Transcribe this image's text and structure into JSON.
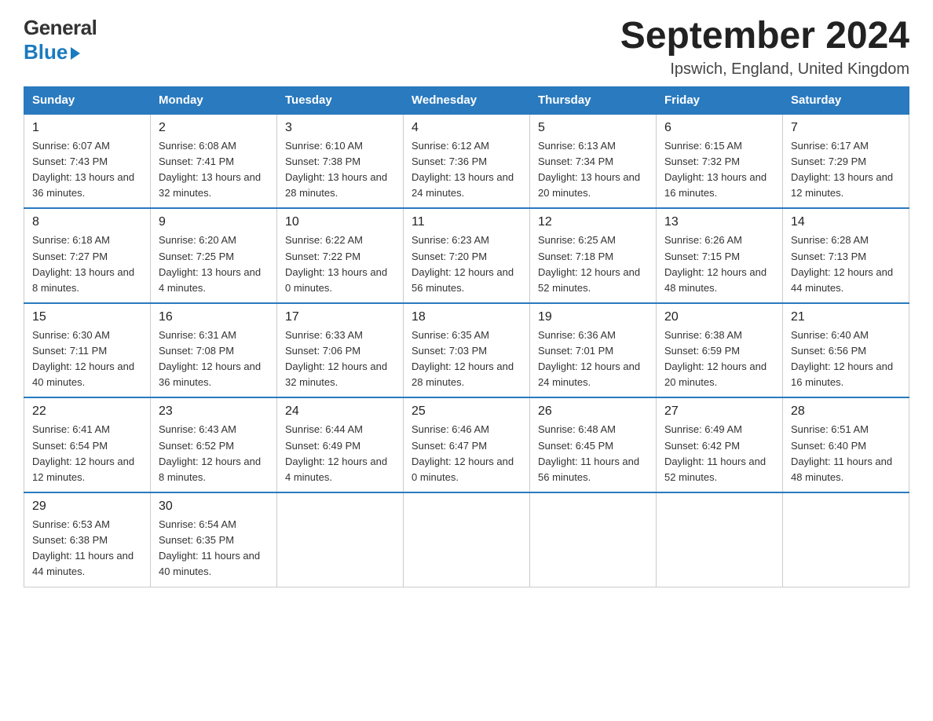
{
  "logo": {
    "general": "General",
    "blue": "Blue"
  },
  "title": "September 2024",
  "location": "Ipswich, England, United Kingdom",
  "days_of_week": [
    "Sunday",
    "Monday",
    "Tuesday",
    "Wednesday",
    "Thursday",
    "Friday",
    "Saturday"
  ],
  "weeks": [
    [
      {
        "num": "1",
        "sunrise": "6:07 AM",
        "sunset": "7:43 PM",
        "daylight": "13 hours and 36 minutes."
      },
      {
        "num": "2",
        "sunrise": "6:08 AM",
        "sunset": "7:41 PM",
        "daylight": "13 hours and 32 minutes."
      },
      {
        "num": "3",
        "sunrise": "6:10 AM",
        "sunset": "7:38 PM",
        "daylight": "13 hours and 28 minutes."
      },
      {
        "num": "4",
        "sunrise": "6:12 AM",
        "sunset": "7:36 PM",
        "daylight": "13 hours and 24 minutes."
      },
      {
        "num": "5",
        "sunrise": "6:13 AM",
        "sunset": "7:34 PM",
        "daylight": "13 hours and 20 minutes."
      },
      {
        "num": "6",
        "sunrise": "6:15 AM",
        "sunset": "7:32 PM",
        "daylight": "13 hours and 16 minutes."
      },
      {
        "num": "7",
        "sunrise": "6:17 AM",
        "sunset": "7:29 PM",
        "daylight": "13 hours and 12 minutes."
      }
    ],
    [
      {
        "num": "8",
        "sunrise": "6:18 AM",
        "sunset": "7:27 PM",
        "daylight": "13 hours and 8 minutes."
      },
      {
        "num": "9",
        "sunrise": "6:20 AM",
        "sunset": "7:25 PM",
        "daylight": "13 hours and 4 minutes."
      },
      {
        "num": "10",
        "sunrise": "6:22 AM",
        "sunset": "7:22 PM",
        "daylight": "13 hours and 0 minutes."
      },
      {
        "num": "11",
        "sunrise": "6:23 AM",
        "sunset": "7:20 PM",
        "daylight": "12 hours and 56 minutes."
      },
      {
        "num": "12",
        "sunrise": "6:25 AM",
        "sunset": "7:18 PM",
        "daylight": "12 hours and 52 minutes."
      },
      {
        "num": "13",
        "sunrise": "6:26 AM",
        "sunset": "7:15 PM",
        "daylight": "12 hours and 48 minutes."
      },
      {
        "num": "14",
        "sunrise": "6:28 AM",
        "sunset": "7:13 PM",
        "daylight": "12 hours and 44 minutes."
      }
    ],
    [
      {
        "num": "15",
        "sunrise": "6:30 AM",
        "sunset": "7:11 PM",
        "daylight": "12 hours and 40 minutes."
      },
      {
        "num": "16",
        "sunrise": "6:31 AM",
        "sunset": "7:08 PM",
        "daylight": "12 hours and 36 minutes."
      },
      {
        "num": "17",
        "sunrise": "6:33 AM",
        "sunset": "7:06 PM",
        "daylight": "12 hours and 32 minutes."
      },
      {
        "num": "18",
        "sunrise": "6:35 AM",
        "sunset": "7:03 PM",
        "daylight": "12 hours and 28 minutes."
      },
      {
        "num": "19",
        "sunrise": "6:36 AM",
        "sunset": "7:01 PM",
        "daylight": "12 hours and 24 minutes."
      },
      {
        "num": "20",
        "sunrise": "6:38 AM",
        "sunset": "6:59 PM",
        "daylight": "12 hours and 20 minutes."
      },
      {
        "num": "21",
        "sunrise": "6:40 AM",
        "sunset": "6:56 PM",
        "daylight": "12 hours and 16 minutes."
      }
    ],
    [
      {
        "num": "22",
        "sunrise": "6:41 AM",
        "sunset": "6:54 PM",
        "daylight": "12 hours and 12 minutes."
      },
      {
        "num": "23",
        "sunrise": "6:43 AM",
        "sunset": "6:52 PM",
        "daylight": "12 hours and 8 minutes."
      },
      {
        "num": "24",
        "sunrise": "6:44 AM",
        "sunset": "6:49 PM",
        "daylight": "12 hours and 4 minutes."
      },
      {
        "num": "25",
        "sunrise": "6:46 AM",
        "sunset": "6:47 PM",
        "daylight": "12 hours and 0 minutes."
      },
      {
        "num": "26",
        "sunrise": "6:48 AM",
        "sunset": "6:45 PM",
        "daylight": "11 hours and 56 minutes."
      },
      {
        "num": "27",
        "sunrise": "6:49 AM",
        "sunset": "6:42 PM",
        "daylight": "11 hours and 52 minutes."
      },
      {
        "num": "28",
        "sunrise": "6:51 AM",
        "sunset": "6:40 PM",
        "daylight": "11 hours and 48 minutes."
      }
    ],
    [
      {
        "num": "29",
        "sunrise": "6:53 AM",
        "sunset": "6:38 PM",
        "daylight": "11 hours and 44 minutes."
      },
      {
        "num": "30",
        "sunrise": "6:54 AM",
        "sunset": "6:35 PM",
        "daylight": "11 hours and 40 minutes."
      },
      null,
      null,
      null,
      null,
      null
    ]
  ]
}
